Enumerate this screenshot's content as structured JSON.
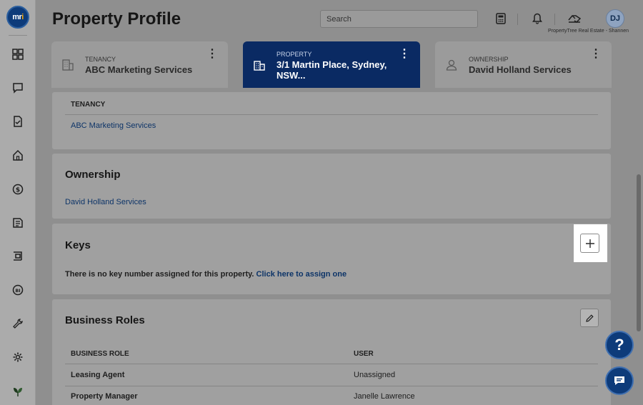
{
  "app": {
    "logo_text_a": "mr",
    "logo_text_b": "i",
    "title": "Property Profile"
  },
  "header": {
    "search_placeholder": "Search",
    "avatar_initials": "DJ",
    "org_label": "PropertyTree Real Estate - Shannen"
  },
  "sidebar": {
    "items": [
      {
        "icon": "dashboard-icon"
      },
      {
        "icon": "chat-icon"
      },
      {
        "icon": "tasks-icon"
      },
      {
        "icon": "home-icon"
      },
      {
        "icon": "dollar-icon"
      },
      {
        "icon": "document-icon"
      },
      {
        "icon": "inspection-icon"
      },
      {
        "icon": "bi-icon"
      },
      {
        "icon": "wrench-icon"
      },
      {
        "icon": "settings-icon"
      },
      {
        "icon": "leaf-icon"
      }
    ]
  },
  "cards": [
    {
      "kicker": "TENANCY",
      "value": "ABC Marketing Services",
      "icon": "building-icon"
    },
    {
      "kicker": "PROPERTY",
      "value": "3/1 Martin Place, Sydney, NSW...",
      "icon": "office-icon",
      "active": true
    },
    {
      "kicker": "OWNERSHIP",
      "value": "David Holland Services",
      "icon": "person-icon"
    }
  ],
  "tenancy_section": {
    "header": "TENANCY",
    "link": "ABC Marketing Services"
  },
  "ownership_section": {
    "title": "Ownership",
    "link": "David Holland Services"
  },
  "keys_section": {
    "title": "Keys",
    "message": "There is no key number assigned for this property.",
    "assign_link": "Click here to assign one"
  },
  "business_roles": {
    "title": "Business Roles",
    "col_role": "BUSINESS ROLE",
    "col_user": "USER",
    "rows": [
      {
        "role": "Leasing Agent",
        "user": "Unassigned"
      },
      {
        "role": "Property Manager",
        "user": "Janelle Lawrence"
      }
    ]
  },
  "fab": {
    "help": "?"
  }
}
